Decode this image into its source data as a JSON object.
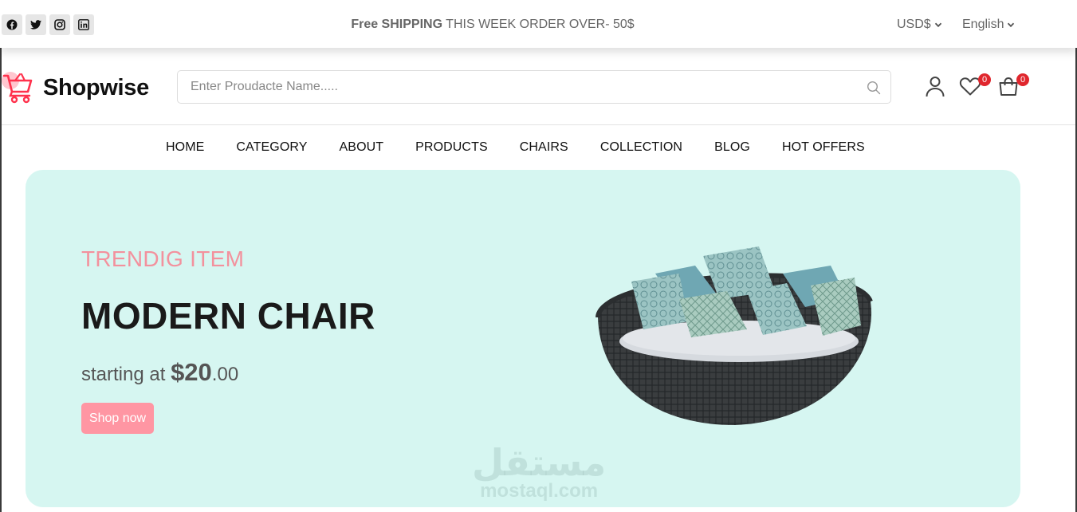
{
  "topbar": {
    "socials": [
      "facebook-icon",
      "twitter-icon",
      "instagram-icon",
      "linkedin-icon"
    ],
    "promo_bold": "Free SHIPPING",
    "promo_rest": " THIS WEEK ORDER OVER- 50$",
    "currency": "USD$",
    "language": "English"
  },
  "header": {
    "logo_text": "Shopwise",
    "search_placeholder": "Enter Proudacte Name.....",
    "wishlist_count": "0",
    "cart_count": "0"
  },
  "nav": {
    "items": [
      "HOME",
      "CATEGORY",
      "ABOUT",
      "PRODUCTS",
      "CHAIRS",
      "COLLECTION",
      "BLOG",
      "HOT OFFERS"
    ]
  },
  "hero": {
    "eyebrow": "TRENDIG ITEM",
    "headline": "MODERN CHAIR",
    "price_prefix": "starting at ",
    "price_amount": "$20",
    "price_cents": ".00",
    "cta": "Shop now"
  },
  "watermark": {
    "arabic": "مستقل",
    "latin": "mostaql.com"
  },
  "colors": {
    "accent": "#ff96a3",
    "hero_bg": "#d6f6f1",
    "badge": "#e0262d",
    "logo": "#ff324d"
  }
}
